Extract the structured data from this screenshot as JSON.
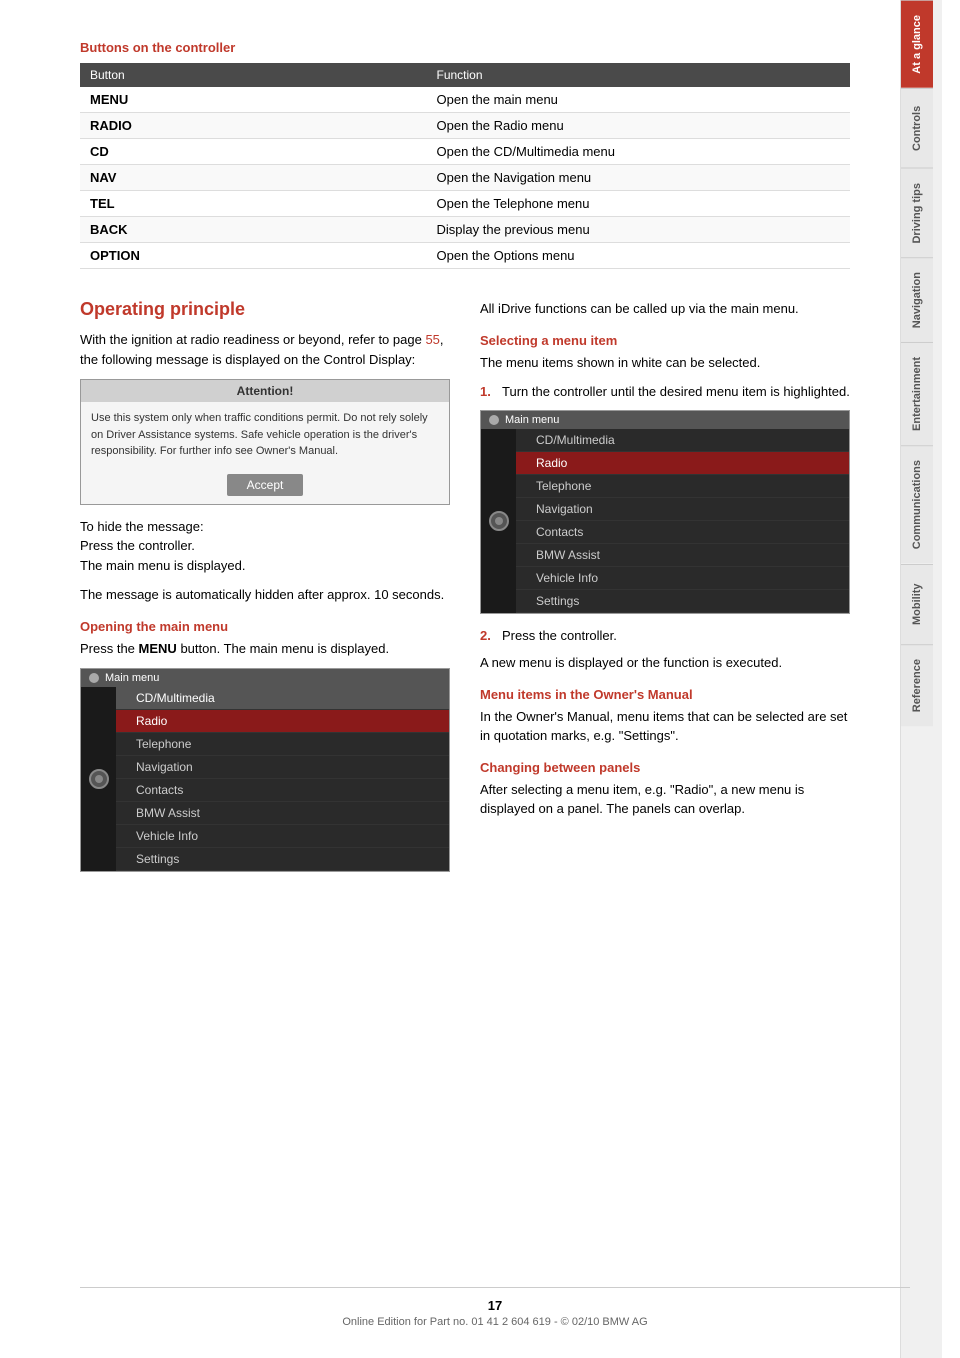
{
  "page": {
    "number": "17",
    "footer_text": "Online Edition for Part no. 01 41 2 604 619 - © 02/10 BMW AG"
  },
  "sidebar": {
    "tabs": [
      {
        "id": "at-a-glance",
        "label": "At a glance",
        "active": true
      },
      {
        "id": "controls",
        "label": "Controls",
        "active": false
      },
      {
        "id": "driving-tips",
        "label": "Driving tips",
        "active": false
      },
      {
        "id": "navigation",
        "label": "Navigation",
        "active": false
      },
      {
        "id": "entertainment",
        "label": "Entertainment",
        "active": false
      },
      {
        "id": "communications",
        "label": "Communications",
        "active": false
      },
      {
        "id": "mobility",
        "label": "Mobility",
        "active": false
      },
      {
        "id": "reference",
        "label": "Reference",
        "active": false
      }
    ]
  },
  "buttons_section": {
    "title": "Buttons on the controller",
    "table": {
      "col_button": "Button",
      "col_function": "Function",
      "rows": [
        {
          "button": "MENU",
          "function": "Open the main menu"
        },
        {
          "button": "RADIO",
          "function": "Open the Radio menu"
        },
        {
          "button": "CD",
          "function": "Open the CD/Multimedia menu"
        },
        {
          "button": "NAV",
          "function": "Open the Navigation menu"
        },
        {
          "button": "TEL",
          "function": "Open the Telephone menu"
        },
        {
          "button": "BACK",
          "function": "Display the previous menu"
        },
        {
          "button": "OPTION",
          "function": "Open the Options menu"
        }
      ]
    }
  },
  "operating_principle": {
    "heading": "Operating principle",
    "intro_text": "With the ignition at radio readiness or beyond, refer to page",
    "intro_link": "55",
    "intro_text2": ", the following message is displayed on the Control Display:",
    "attention_header": "Attention!",
    "attention_body": "Use this system only when traffic conditions permit. Do not rely solely on Driver Assistance systems. Safe vehicle operation is the driver's responsibility. For further info see Owner's Manual.",
    "accept_button": "Accept",
    "hide_msg_text": "To hide the message:\nPress the controller.\nThe main menu is displayed.",
    "auto_hide_text": "The message is automatically hidden after approx. 10 seconds.",
    "open_main_menu_heading": "Opening the main menu",
    "open_main_menu_text": "Press the",
    "open_main_menu_bold": "MENU",
    "open_main_menu_text2": "button.\nThe main menu is displayed.",
    "main_menu_label": "Main menu",
    "main_menu_items": [
      {
        "label": "CD/Multimedia",
        "style": "selected"
      },
      {
        "label": "Radio",
        "style": "highlighted"
      },
      {
        "label": "Telephone",
        "style": "normal"
      },
      {
        "label": "Navigation",
        "style": "normal"
      },
      {
        "label": "Contacts",
        "style": "normal"
      },
      {
        "label": "BMW Assist",
        "style": "normal"
      },
      {
        "label": "Vehicle Info",
        "style": "normal"
      },
      {
        "label": "Settings",
        "style": "normal"
      }
    ],
    "right_col": {
      "all_functions_text": "All iDrive functions can be called up via the main menu.",
      "selecting_heading": "Selecting a menu item",
      "selecting_text": "The menu items shown in white can be selected.",
      "step1_num": "1.",
      "step1_text": "Turn the controller until the desired menu item is highlighted.",
      "main_menu_label2": "Main menu",
      "main_menu_items2": [
        {
          "label": "CD/Multimedia",
          "style": "normal"
        },
        {
          "label": "Radio",
          "style": "highlighted"
        },
        {
          "label": "Telephone",
          "style": "normal"
        },
        {
          "label": "Navigation",
          "style": "normal"
        },
        {
          "label": "Contacts",
          "style": "normal"
        },
        {
          "label": "BMW Assist",
          "style": "normal"
        },
        {
          "label": "Vehicle Info",
          "style": "normal"
        },
        {
          "label": "Settings",
          "style": "normal"
        }
      ],
      "step2_num": "2.",
      "step2_text": "Press the controller.",
      "new_menu_text": "A new menu is displayed or the function is executed.",
      "owner_manual_heading": "Menu items in the Owner's Manual",
      "owner_manual_text": "In the Owner's Manual, menu items that can be selected are set in quotation marks, e.g. \"Settings\".",
      "changing_panels_heading": "Changing between panels",
      "changing_panels_text": "After selecting a menu item, e.g. \"Radio\", a new menu is displayed on a panel. The panels can overlap."
    }
  }
}
